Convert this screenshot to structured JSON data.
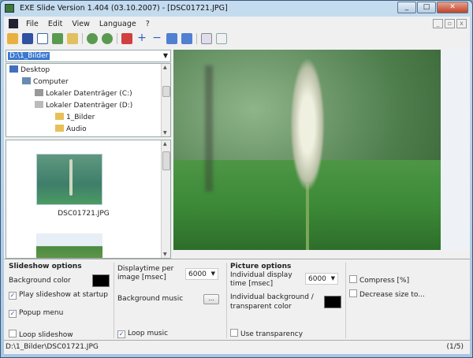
{
  "window": {
    "title": "EXE Slide Version 1.404 (03.10.2007) - [DSC01721.JPG]"
  },
  "menu": [
    "File",
    "Edit",
    "View",
    "Language",
    "?"
  ],
  "folder_combo": {
    "value": "D:\\1_Bilder"
  },
  "tree": [
    {
      "label": "Desktop",
      "icon": "desktop-icon"
    },
    {
      "label": "Computer",
      "icon": "computer-icon"
    },
    {
      "label": "Lokaler Datenträger (C:)",
      "icon": "drive-icon"
    },
    {
      "label": "Lokaler Datenträger (D:)",
      "icon": "drive-icon"
    },
    {
      "label": "1_Bilder",
      "icon": "folder-icon"
    },
    {
      "label": "Audio",
      "icon": "folder-icon"
    }
  ],
  "thumbnails": [
    {
      "label": "DSC01721.JPG"
    }
  ],
  "slideshow": {
    "heading": "Slideshow options",
    "bg_color_label": "Background color",
    "bg_color": "#000000",
    "play_at_startup": {
      "label": "Play slideshow at startup",
      "checked": true
    },
    "popup_menu": {
      "label": "Popup menu",
      "checked": true
    },
    "loop_slideshow": {
      "label": "Loop slideshow",
      "checked": false
    },
    "displaytime_label": "Displaytime per image [msec]",
    "displaytime_value": "6000",
    "bg_music_label": "Background music",
    "bg_music_button": "...",
    "loop_music": {
      "label": "Loop music",
      "checked": true
    }
  },
  "picture": {
    "heading": "Picture options",
    "display_time_label": "Individual display time [msec]",
    "display_time_value": "6000",
    "bg_label": "Individual background / transparent color",
    "bg_color": "#000000",
    "use_transparency": {
      "label": "Use transparency",
      "checked": false
    },
    "compress": {
      "label": "Compress [%]",
      "checked": false
    },
    "decrease": {
      "label": "Decrease size to...",
      "checked": false
    }
  },
  "status": {
    "path": "D:\\1_Bilder\\DSC01721.JPG",
    "counter": "(1/5)"
  }
}
